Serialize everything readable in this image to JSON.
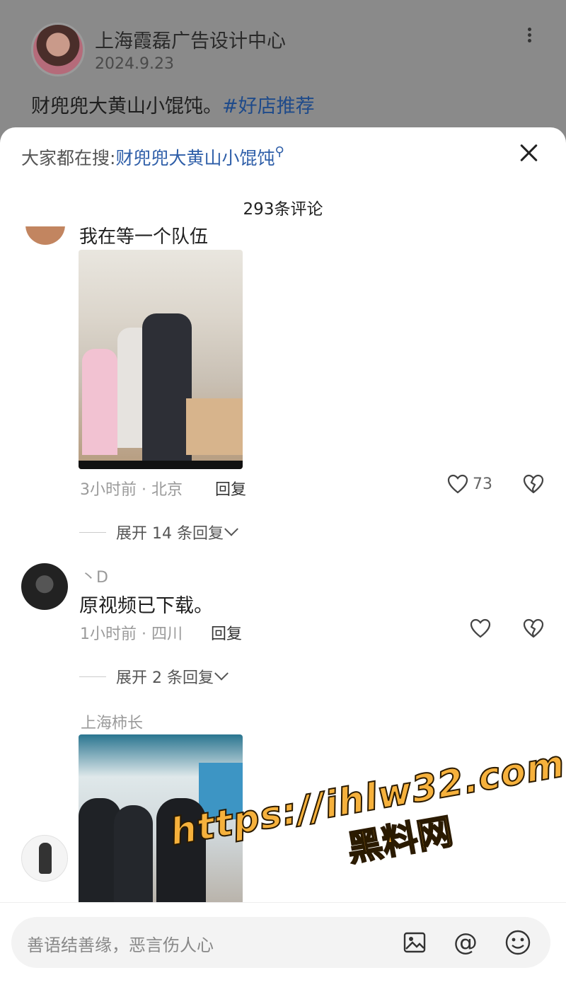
{
  "post": {
    "author": "上海霞磊广告设计中心",
    "date": "2024.9.23",
    "text": "财兜兜大黄山小馄饨。",
    "tag": "#好店推荐"
  },
  "sheet": {
    "search_prefix": "大家都在搜:",
    "search_keyword": "财兜兜大黄山小馄饨",
    "comment_count": "293条评论"
  },
  "comments": [
    {
      "text": "我在等一个队伍",
      "time_location": "3小时前 · 北京",
      "reply": "回复",
      "likes": "73",
      "expand": "展开 14 条回复"
    },
    {
      "username": "丶D",
      "text": "原视频已下载。",
      "time_location": "1小时前 · 四川",
      "reply": "回复",
      "likes": "",
      "expand": "展开 2 条回复"
    },
    {
      "username": "上海柿长"
    }
  ],
  "input": {
    "placeholder": "善语结善缘，恶言伤人心"
  },
  "watermark": {
    "url": "https://ihlw32.com",
    "text": "黑料网"
  },
  "colors": {
    "link": "#2e5ea8",
    "watermark": "#f6b13c"
  }
}
